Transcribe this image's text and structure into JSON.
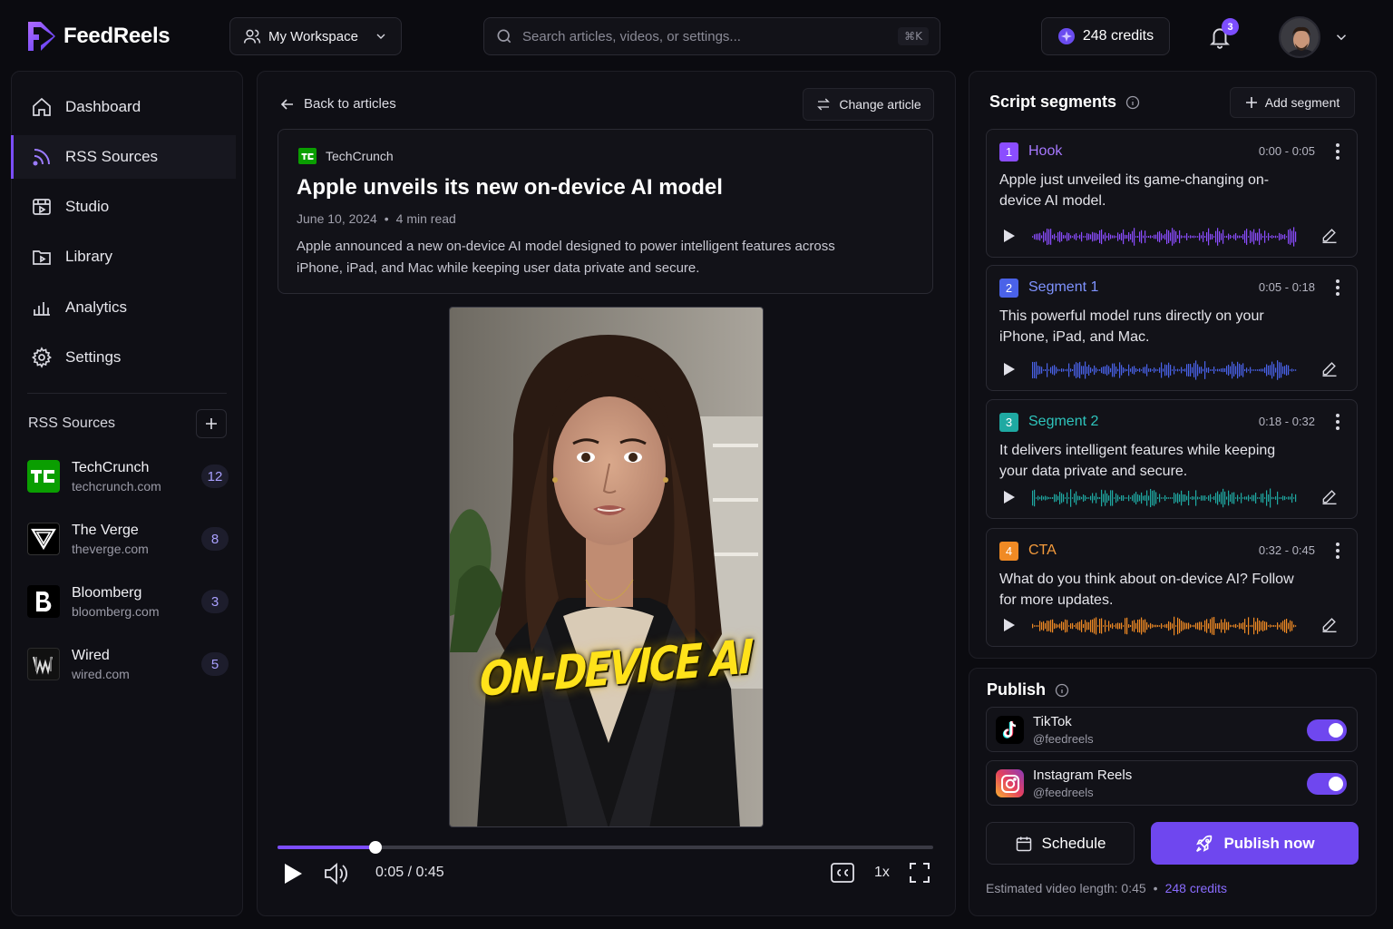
{
  "app": {
    "name": "FeedReels"
  },
  "header": {
    "workspace_label": "My Workspace",
    "search_placeholder": "Search articles, videos, or settings...",
    "search_shortcut": "⌘K",
    "credits_label": "248 credits",
    "notification_count": "3"
  },
  "sidebar": {
    "nav": [
      {
        "label": "Dashboard",
        "icon": "home-icon"
      },
      {
        "label": "RSS Sources",
        "icon": "rss-icon",
        "active": true
      },
      {
        "label": "Studio",
        "icon": "studio-icon"
      },
      {
        "label": "Library",
        "icon": "folder-icon"
      },
      {
        "label": "Analytics",
        "icon": "analytics-icon"
      },
      {
        "label": "Settings",
        "icon": "gear-icon"
      }
    ],
    "rss_heading": "RSS Sources",
    "sources": [
      {
        "name": "TechCrunch",
        "url": "techcrunch.com",
        "count": "12",
        "color": "#0a9e01"
      },
      {
        "name": "The Verge",
        "url": "theverge.com",
        "count": "8",
        "color": "#000000"
      },
      {
        "name": "Bloomberg",
        "url": "bloomberg.com",
        "count": "3",
        "color": "#000000"
      },
      {
        "name": "Wired",
        "url": "wired.com",
        "count": "5",
        "color": "#000000"
      }
    ]
  },
  "center": {
    "back_label": "Back to articles",
    "change_label": "Change article",
    "article": {
      "source": "TechCrunch",
      "title": "Apple unveils its new on-device AI model",
      "date": "June 10, 2024",
      "read_time": "4 min read",
      "description": "Apple announced a new on-device AI model designed to power intelligent features across iPhone, iPad, and Mac while keeping user data private and secure."
    },
    "video": {
      "caption": "ON-DEVICE AI",
      "time_label": "0:05 / 0:45",
      "progress": 0.15,
      "speed": "1x"
    }
  },
  "segments": {
    "heading": "Script segments",
    "add_label": "Add segment",
    "items": [
      {
        "num": "1",
        "name": "Hook",
        "time": "0:00 - 0:05",
        "text": "Apple just unveiled its game-changing on-device AI model.",
        "color": "#8b4dff"
      },
      {
        "num": "2",
        "name": "Segment 1",
        "time": "0:05 - 0:18",
        "text": "This powerful model runs directly on your iPhone, iPad, and Mac.",
        "color": "#4a62e8"
      },
      {
        "num": "3",
        "name": "Segment 2",
        "time": "0:18 - 0:32",
        "text": "It delivers intelligent features while keeping your data private and secure.",
        "color": "#1fa9a2"
      },
      {
        "num": "4",
        "name": "CTA",
        "time": "0:32 - 0:45",
        "text": "What do you think about on-device AI? Follow for more updates.",
        "color": "#f08a24"
      }
    ]
  },
  "publish": {
    "heading": "Publish",
    "platforms": [
      {
        "name": "TikTok",
        "handle": "@feedreels",
        "enabled": true
      },
      {
        "name": "Instagram Reels",
        "handle": "@feedreels",
        "enabled": true
      }
    ],
    "schedule_label": "Schedule",
    "publish_label": "Publish now",
    "estimate_label": "Estimated video length: 0:45",
    "estimate_credits": "248 credits"
  }
}
